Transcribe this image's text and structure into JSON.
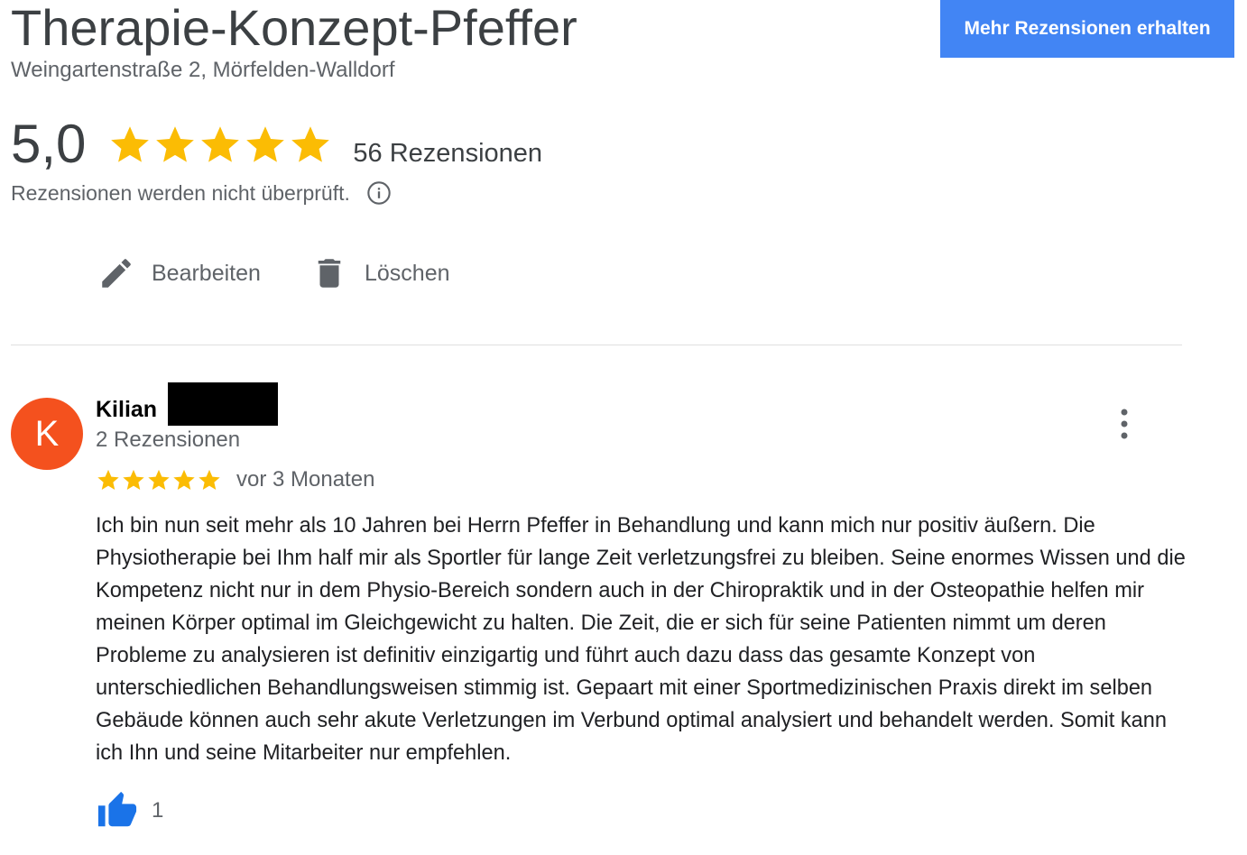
{
  "business": {
    "name": "Therapie-Konzept-Pfeffer",
    "address": "Weingartenstraße 2, Mörfelden-Walldorf"
  },
  "header": {
    "more_reviews_button": "Mehr Rezensionen erhalten"
  },
  "rating": {
    "value": "5,0",
    "stars": 5,
    "review_count": "56 Rezensionen",
    "disclaimer": "Rezensionen werden nicht überprüft."
  },
  "actions": {
    "edit_label": "Bearbeiten",
    "delete_label": "Löschen"
  },
  "review": {
    "avatar_letter": "K",
    "reviewer_name": "Kilian",
    "reviewer_reviews": "2 Rezensionen",
    "stars": 5,
    "date": "vor 3 Monaten",
    "text": "Ich bin nun seit mehr als 10 Jahren bei Herrn Pfeffer in Behandlung und kann mich nur positiv äußern. Die Physiotherapie bei Ihm half mir als Sportler für lange Zeit verletzungsfrei zu bleiben. Seine enormes Wissen und die Kompetenz nicht nur in dem Physio-Bereich sondern auch in der Chiropraktik und in der Osteopathie helfen mir meinen Körper optimal im Gleichgewicht zu halten. Die Zeit, die er sich für seine Patienten nimmt um deren Probleme zu analysieren ist definitiv einzigartig und führt auch dazu dass das gesamte Konzept von unterschiedlichen Behandlungsweisen stimmig ist. Gepaart mit einer Sportmedizinischen Praxis direkt im selben Gebäude können auch sehr akute Verletzungen im Verbund optimal analysiert und behandelt werden. Somit kann ich Ihn und seine Mitarbeiter nur empfehlen.",
    "likes": "1"
  },
  "colors": {
    "star": "#fbbc04",
    "button_blue": "#4285f4",
    "avatar_bg": "#f4511e",
    "like_blue": "#1a73e8"
  },
  "icons": [
    "star-icon",
    "info-icon",
    "pencil-icon",
    "trash-icon",
    "more-vert-icon",
    "thumbs-up-icon"
  ]
}
